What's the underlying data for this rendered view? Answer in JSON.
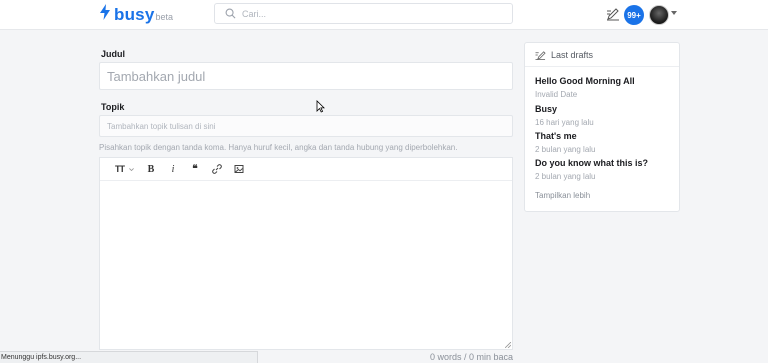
{
  "header": {
    "logo_text": "busy",
    "logo_suffix": "beta",
    "search_placeholder": "Cari...",
    "notification_count": "99+",
    "brand_color": "#1a73e8"
  },
  "editor": {
    "title_label": "Judul",
    "title_placeholder": "Tambahkan judul",
    "topic_label": "Topik",
    "topic_placeholder": "Tambahkan topik tulisan di sini",
    "topic_hint": "Pisahkan topik dengan tanda koma. Hanya huruf kecil, angka dan tanda hubung yang diperbolehkan.",
    "toolbar": {
      "heading": "TT",
      "bold": "B",
      "italic": "i",
      "quote": "❝",
      "icons": [
        "heading-icon",
        "bold-icon",
        "italic-icon",
        "quote-icon",
        "link-icon",
        "image-icon"
      ]
    },
    "word_count": "0 words / 0 min baca"
  },
  "drafts": {
    "title": "Last drafts",
    "items": [
      {
        "title": "Hello Good Morning All",
        "date": "Invalid Date"
      },
      {
        "title": "Busy",
        "date": "16 hari yang lalu"
      },
      {
        "title": "That's me",
        "date": "2 bulan yang lalu"
      },
      {
        "title": "Do you know what this is?",
        "date": "2 bulan yang lalu"
      }
    ],
    "show_more": "Tampilkan lebih"
  },
  "status_bar": "Menunggu ipfs.busy.org..."
}
